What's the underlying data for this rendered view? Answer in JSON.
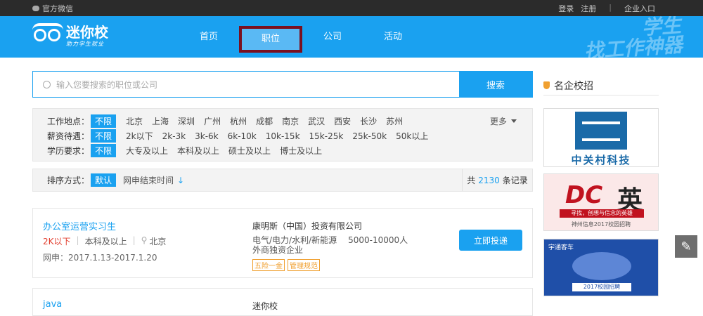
{
  "topbar": {
    "wechat": "官方微信",
    "login": "登录",
    "register": "注册",
    "sep": "|",
    "enterprise": "企业入口"
  },
  "header": {
    "logo_title": "迷你校",
    "logo_sub": "助力学生就业",
    "nav": [
      "首页",
      "职位",
      "公司",
      "活动"
    ],
    "active_nav": "职位",
    "slogan_line1": "学生",
    "slogan_line2": "找工作神器"
  },
  "search": {
    "placeholder": "输入您要搜索的职位或公司",
    "button": "搜索"
  },
  "filters": {
    "location_label": "工作地点：",
    "locations": [
      "不限",
      "北京",
      "上海",
      "深圳",
      "广州",
      "杭州",
      "成都",
      "南京",
      "武汉",
      "西安",
      "长沙",
      "苏州"
    ],
    "more": "更多",
    "salary_label": "薪资待遇：",
    "salaries": [
      "不限",
      "2k以下",
      "2k-3k",
      "3k-6k",
      "6k-10k",
      "10k-15k",
      "15k-25k",
      "25k-50k",
      "50k以上"
    ],
    "edu_label": "学历要求：",
    "edus": [
      "不限",
      "大专及以上",
      "本科及以上",
      "硕士及以上",
      "博士及以上"
    ]
  },
  "sort": {
    "label": "排序方式：",
    "default": "默认",
    "by": "网申结束时间",
    "arrow": "↓",
    "total_prefix": "共",
    "total": "2130",
    "total_suffix": "条记录"
  },
  "jobs": [
    {
      "title": "办公室运营实习生",
      "salary": "2K以下",
      "edu": "本科及以上",
      "city": "北京",
      "date": "网申：2017.1.13-2017.1.20",
      "company": "康明斯（中国）投资有限公司",
      "industry": "电气/电力/水利/新能源",
      "size": "5000-10000人",
      "type": "外商独资企业",
      "tags": [
        "五险一金",
        "管理规范"
      ],
      "apply": "立即投递"
    },
    {
      "title": "java",
      "company": "迷你校"
    }
  ],
  "sidebar": {
    "title": "名企校招",
    "ad1_text": "中关村科技",
    "ad2_dc": "DC",
    "ad2_ying": "英",
    "ad2_line": "寻找，创想与信念的英雄",
    "ad2_foot": "神州信息2017校园招聘",
    "ad3_brand": "宇通客车",
    "ad3_label": "2017校园招聘"
  },
  "edit_icon": "✎"
}
